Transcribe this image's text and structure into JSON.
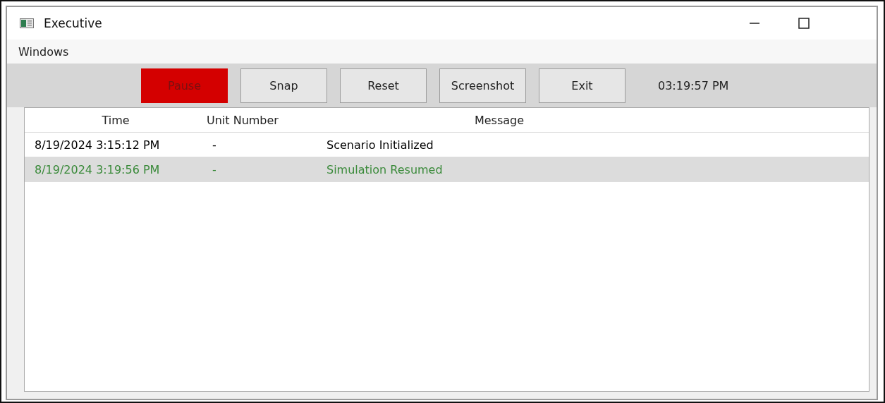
{
  "window": {
    "title": "Executive"
  },
  "menu": [
    "Windows"
  ],
  "toolbar": {
    "buttons": [
      {
        "label": "Pause",
        "highlighted": true
      },
      {
        "label": "Snap",
        "highlighted": false
      },
      {
        "label": "Reset",
        "highlighted": false
      },
      {
        "label": "Screenshot",
        "highlighted": false
      },
      {
        "label": "Exit",
        "highlighted": false
      }
    ],
    "clock": "03:19:57 PM"
  },
  "table": {
    "columns": [
      "Time",
      "Unit Number",
      "Message"
    ],
    "rows": [
      {
        "cells": [
          "8/19/2024 3:15:12 PM",
          "-",
          "Scenario Initialized"
        ],
        "selected": false,
        "color": "#000000"
      },
      {
        "cells": [
          "8/19/2024 3:19:56 PM",
          "-",
          "Simulation Resumed"
        ],
        "selected": true,
        "color": "#3a8a3a"
      }
    ]
  }
}
